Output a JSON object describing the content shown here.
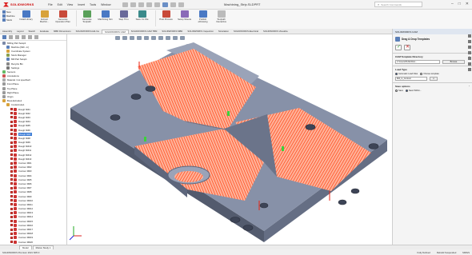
{
  "app": {
    "brand": "SOLIDWORKS",
    "menus": [
      "File",
      "Edit",
      "View",
      "Insert",
      "Tools",
      "Window"
    ],
    "doc_title": "Machining_Strip.SLDPRT",
    "search_placeholder": "Search Commands"
  },
  "ribbon": {
    "buttons": [
      {
        "label": "Install Library",
        "icon": "library-icon"
      },
      {
        "label": "Extract Machin...",
        "icon": "extract-machinable-features-icon"
      },
      {
        "label": "Generate Operation Plan",
        "icon": "generate-operation-plan-icon"
      },
      {
        "label": "Generate Toolpath",
        "icon": "generate-toolpath-icon"
      },
      {
        "label": "Machining Sim",
        "icon": "simulate-toolpath-icon"
      },
      {
        "label": "Step Thru",
        "icon": "step-through-icon"
      },
      {
        "label": "Save CL File",
        "icon": "save-cl-file-icon"
      },
      {
        "label": "Post Process",
        "icon": "post-process-icon"
      },
      {
        "label": "Setup Sheets",
        "icon": "setup-sheets-icon"
      },
      {
        "label": "Publish eDrawing",
        "icon": "publish-edrawing-icon"
      },
      {
        "label": "Toolpath Interactive",
        "icon": "toolpath-interactive-icon"
      }
    ],
    "small_items": [
      "New",
      "Machine",
      "Stock"
    ]
  },
  "command_tabs": [
    "Assembly",
    "Layout",
    "Sketch",
    "Evaluate",
    "MBD Dimensions",
    "SOLIDWORKS Add-Ins",
    "SOLIDWORKS CAM",
    "SOLIDWORKS CAM TBM",
    "SOLIDWORKS MBD",
    "SOLIDWORKS Inspection",
    "Simulation",
    "SOLIDWORKS Electrical",
    "SOLIDWORKS Visualize"
  ],
  "command_tabs_active": 6,
  "tree": {
    "rows": [
      {
        "label": "Milling Part Setup1",
        "indent": 0,
        "icon": "part-icon",
        "color": "#7b8aa8"
      },
      {
        "label": "Machine [Mill - in]",
        "indent": 1,
        "icon": "machine-icon",
        "color": "#5a7fb8"
      },
      {
        "label": "Coordinate System",
        "indent": 1,
        "icon": "coordinate-icon",
        "color": "#d8a23a"
      },
      {
        "label": "Stock Manager",
        "indent": 1,
        "icon": "stock-icon",
        "color": "#8aa04f"
      },
      {
        "label": "Mill Part Setup1",
        "indent": 1,
        "icon": "setup-icon",
        "color": "#5a7fb8"
      },
      {
        "label": "Recycle Bin",
        "indent": 1,
        "icon": "recycle-icon",
        "color": "#888"
      },
      {
        "label": "Settings",
        "indent": 1,
        "icon": "settings-icon",
        "color": "#777"
      },
      {
        "label": "Sensors",
        "indent": 0,
        "icon": "sensor-icon",
        "color": "#6b6"
      },
      {
        "label": "Annotations",
        "indent": 0,
        "icon": "annotation-icon",
        "color": "#c55"
      },
      {
        "label": "Material <not specified>",
        "indent": 0,
        "icon": "material-icon",
        "color": "#aaa"
      },
      {
        "label": "Front Plane",
        "indent": 0,
        "icon": "plane-icon",
        "color": "#999"
      },
      {
        "label": "Top Plane",
        "indent": 0,
        "icon": "plane-icon",
        "color": "#999"
      },
      {
        "label": "Right Plane",
        "indent": 0,
        "icon": "plane-icon",
        "color": "#999"
      },
      {
        "label": "Origin",
        "indent": 0,
        "icon": "origin-icon",
        "color": "#999"
      },
      {
        "label": "Boss-Extrude1",
        "indent": 0,
        "icon": "feature-icon",
        "color": "#d8a23a"
      },
      {
        "label": "Cut-Extrude1",
        "indent": 1,
        "icon": "feature-icon",
        "color": "#d8a23a"
      },
      {
        "label": "Rough Mill1",
        "indent": 2,
        "icon": "operation-icon",
        "color": "#c33",
        "check": true
      },
      {
        "label": "Rough Mill2",
        "indent": 2,
        "icon": "operation-icon",
        "color": "#c33",
        "check": true
      },
      {
        "label": "Rough Mill3",
        "indent": 2,
        "icon": "operation-icon",
        "color": "#c33",
        "check": true
      },
      {
        "label": "Rough Mill4",
        "indent": 2,
        "icon": "operation-icon",
        "color": "#c33",
        "check": true
      },
      {
        "label": "Rough Mill5",
        "indent": 2,
        "icon": "operation-icon",
        "color": "#c33",
        "check": true
      },
      {
        "label": "Rough Mill6",
        "indent": 2,
        "icon": "operation-icon",
        "color": "#c33",
        "check": true
      },
      {
        "label": "Rough Mill7",
        "indent": 2,
        "icon": "operation-icon",
        "color": "#c33",
        "check": true,
        "selected": true
      },
      {
        "label": "Rough Mill8",
        "indent": 2,
        "icon": "operation-icon",
        "color": "#c33",
        "check": true
      },
      {
        "label": "Rough Mill9",
        "indent": 2,
        "icon": "operation-icon",
        "color": "#c33",
        "check": true
      },
      {
        "label": "Rough Mill10",
        "indent": 2,
        "icon": "operation-icon",
        "color": "#c33",
        "check": true
      },
      {
        "label": "Rough Mill11",
        "indent": 2,
        "icon": "operation-icon",
        "color": "#c33",
        "check": true
      },
      {
        "label": "Rough Mill12",
        "indent": 2,
        "icon": "operation-icon",
        "color": "#c33",
        "check": true
      },
      {
        "label": "Rough Mill13",
        "indent": 2,
        "icon": "operation-icon",
        "color": "#c33",
        "check": true
      },
      {
        "label": "Contour Mill1",
        "indent": 2,
        "icon": "operation-icon",
        "color": "#c33",
        "check": true
      },
      {
        "label": "Contour Mill2",
        "indent": 2,
        "icon": "operation-icon",
        "color": "#c33",
        "check": true
      },
      {
        "label": "Contour Mill3",
        "indent": 2,
        "icon": "operation-icon",
        "color": "#c33",
        "check": true
      },
      {
        "label": "Contour Mill4",
        "indent": 2,
        "icon": "operation-icon",
        "color": "#c33",
        "check": true
      },
      {
        "label": "Contour Mill5",
        "indent": 2,
        "icon": "operation-icon",
        "color": "#c33",
        "check": true
      },
      {
        "label": "Contour Mill6",
        "indent": 2,
        "icon": "operation-icon",
        "color": "#c33",
        "check": true
      },
      {
        "label": "Contour Mill7",
        "indent": 2,
        "icon": "operation-icon",
        "color": "#c33",
        "check": true
      },
      {
        "label": "Contour Mill8",
        "indent": 2,
        "icon": "operation-icon",
        "color": "#c33",
        "check": true
      },
      {
        "label": "Contour Mill9",
        "indent": 2,
        "icon": "operation-icon",
        "color": "#c33",
        "check": true
      },
      {
        "label": "Contour Mill10",
        "indent": 2,
        "icon": "operation-icon",
        "color": "#c33",
        "check": true
      },
      {
        "label": "Contour Mill11",
        "indent": 2,
        "icon": "operation-icon",
        "color": "#c33",
        "check": true
      },
      {
        "label": "Contour Mill12",
        "indent": 2,
        "icon": "operation-icon",
        "color": "#c33",
        "check": true
      },
      {
        "label": "Contour Mill13",
        "indent": 2,
        "icon": "operation-icon",
        "color": "#c33",
        "check": true
      },
      {
        "label": "Contour Mill14",
        "indent": 2,
        "icon": "operation-icon",
        "color": "#c33",
        "check": true
      },
      {
        "label": "Contour Mill15",
        "indent": 2,
        "icon": "operation-icon",
        "color": "#c33",
        "check": true
      },
      {
        "label": "Contour Mill16",
        "indent": 2,
        "icon": "operation-icon",
        "color": "#c33",
        "check": true
      },
      {
        "label": "Contour Mill17",
        "indent": 2,
        "icon": "operation-icon",
        "color": "#c33",
        "check": true
      },
      {
        "label": "Contour Mill18",
        "indent": 2,
        "icon": "operation-icon",
        "color": "#c33",
        "check": true
      },
      {
        "label": "Contour Mill19",
        "indent": 2,
        "icon": "operation-icon",
        "color": "#c33",
        "check": true
      },
      {
        "label": "Contour Mill20",
        "indent": 2,
        "icon": "operation-icon",
        "color": "#c33",
        "check": true
      }
    ]
  },
  "panel": {
    "header": "SOLIDWORKS CAM",
    "title": "Drag & Drop Templates",
    "sec1_title": "CAM Template Directory",
    "dir_value": "C:\\Users\\Public\\Doc...",
    "browse_label": "Browse",
    "sec2_title": "Load Type",
    "opt_automatic": "Automatic Load Files",
    "opt_choose": "Choose template",
    "template_value": "Mill_in_Contour",
    "sec3_title": "Save options",
    "opt_save": "Save",
    "opt_save_as": "Save Within..."
  },
  "bottom_tabs": [
    "Model",
    "Motion Study 1"
  ],
  "status": {
    "left": "SOLIDWORKS Premium 2021 SP0.0",
    "fully_defined": "Fully Defined",
    "rebuild": "Rebuild Suspended",
    "units": "MMGS"
  },
  "colors": {
    "toolpath": "#ff4a1a",
    "part_top": "#7f8aa3",
    "part_side": "#5d667c",
    "brand": "#cc0000"
  }
}
